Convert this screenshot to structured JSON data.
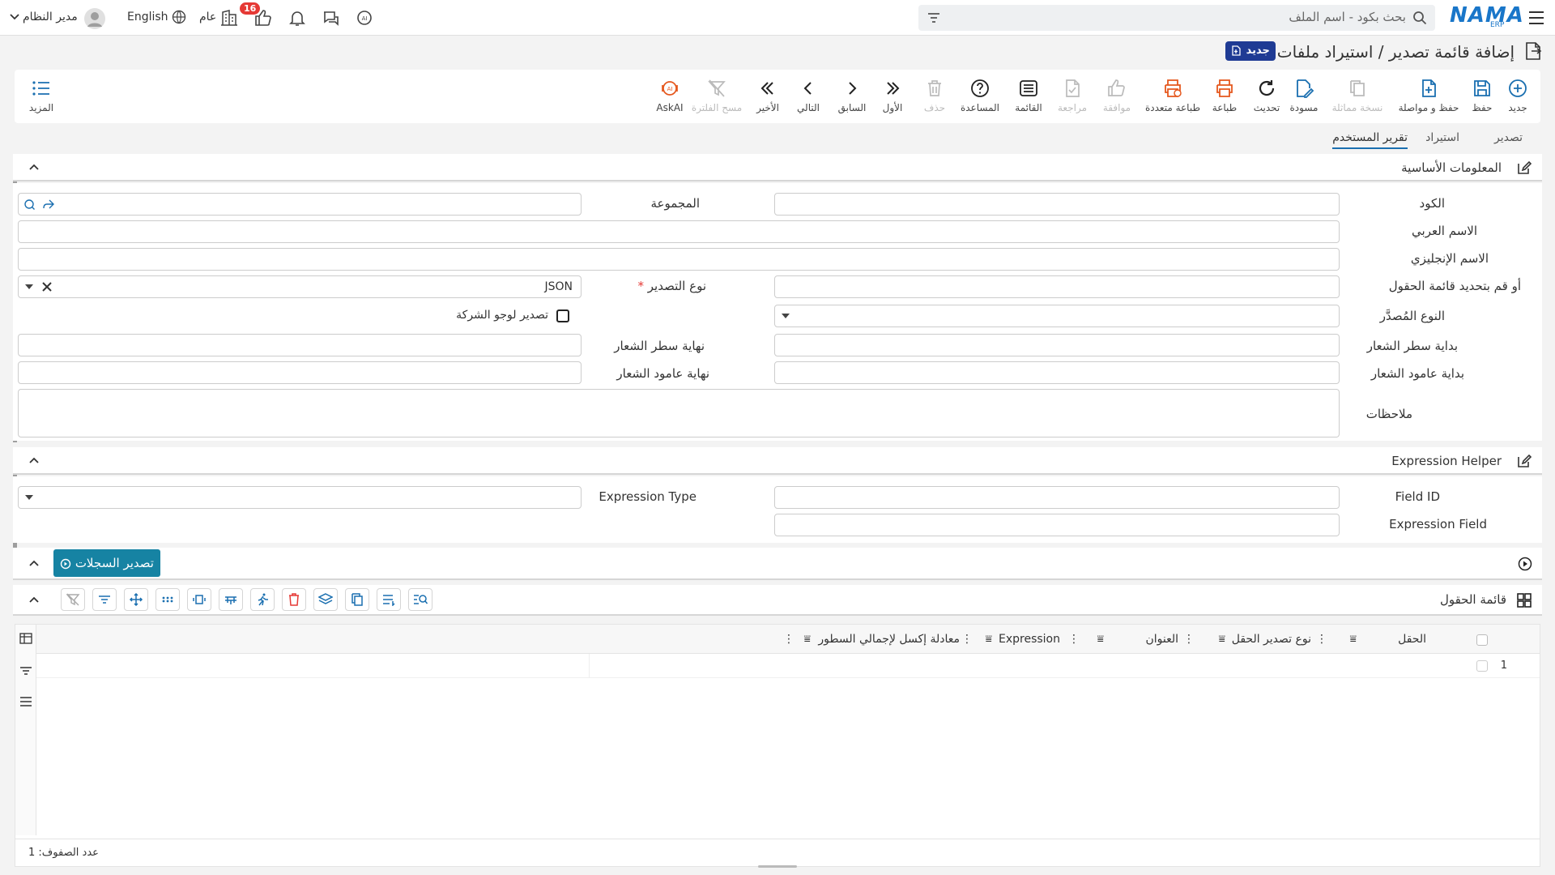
{
  "topbar": {
    "logo": "NAMA",
    "logo_sub": "ERP",
    "search_placeholder": "بحث بكود - اسم الملف",
    "notification_count": "16",
    "general_label": "عام",
    "language_label": "English",
    "user_name": "مدير النظام"
  },
  "page": {
    "title": "إضافة قائمة تصدير / استيراد ملفات",
    "badge": "جديد"
  },
  "toolbar": {
    "new": "جديد",
    "save": "حفظ",
    "save_continue": "حفظ و مواصلة",
    "duplicate": "نسخة مماثلة",
    "draft": "مسودة",
    "refresh": "تحديث",
    "print": "طباعة",
    "multi_print": "طباعة متعددة",
    "approve": "موافقة",
    "review": "مراجعة",
    "list": "القائمة",
    "help": "المساعدة",
    "delete": "حذف",
    "first": "الأول",
    "previous": "السابق",
    "next": "التالي",
    "last": "الأخير",
    "clear_filter": "مسح الفلترة",
    "ask_ai": "AskAI",
    "more": "المزيد"
  },
  "tabs": [
    "تصدير",
    "استيراد",
    "تقرير المستخدم"
  ],
  "basic": {
    "title": "المعلومات الأساسية",
    "code": "الكود",
    "group": "المجموعة",
    "arabic_name": "الاسم العربي",
    "english_name": "الاسم الإنجليزي",
    "fields_list": "أو قم بتحديد قائمة الحقول",
    "export_type": "نوع التصدير",
    "export_type_value": "JSON",
    "source_type": "النوع المُصدَّر",
    "export_logo": "تصدير لوجو الشركة",
    "logo_row_start": "بداية سطر الشعار",
    "logo_row_end": "نهاية سطر الشعار",
    "logo_col_start": "بداية عامود الشعار",
    "logo_col_end": "نهاية عامود الشعار",
    "notes": "ملاحظات"
  },
  "expr": {
    "title": "Expression Helper",
    "field_id": "Field ID",
    "expression_type": "Expression Type",
    "expression_field": "Expression Field"
  },
  "export_records": "تصدير السجلات",
  "fields_grid": {
    "title": "قائمة الحقول",
    "columns": [
      "الحقل",
      "نوع تصدير الحقل",
      "العنوان",
      "Expression",
      "معادلة إكسل لإجمالي السطور"
    ],
    "rows": [
      "1"
    ],
    "row_count_label": "عدد الصفوف:",
    "row_count": "1"
  }
}
